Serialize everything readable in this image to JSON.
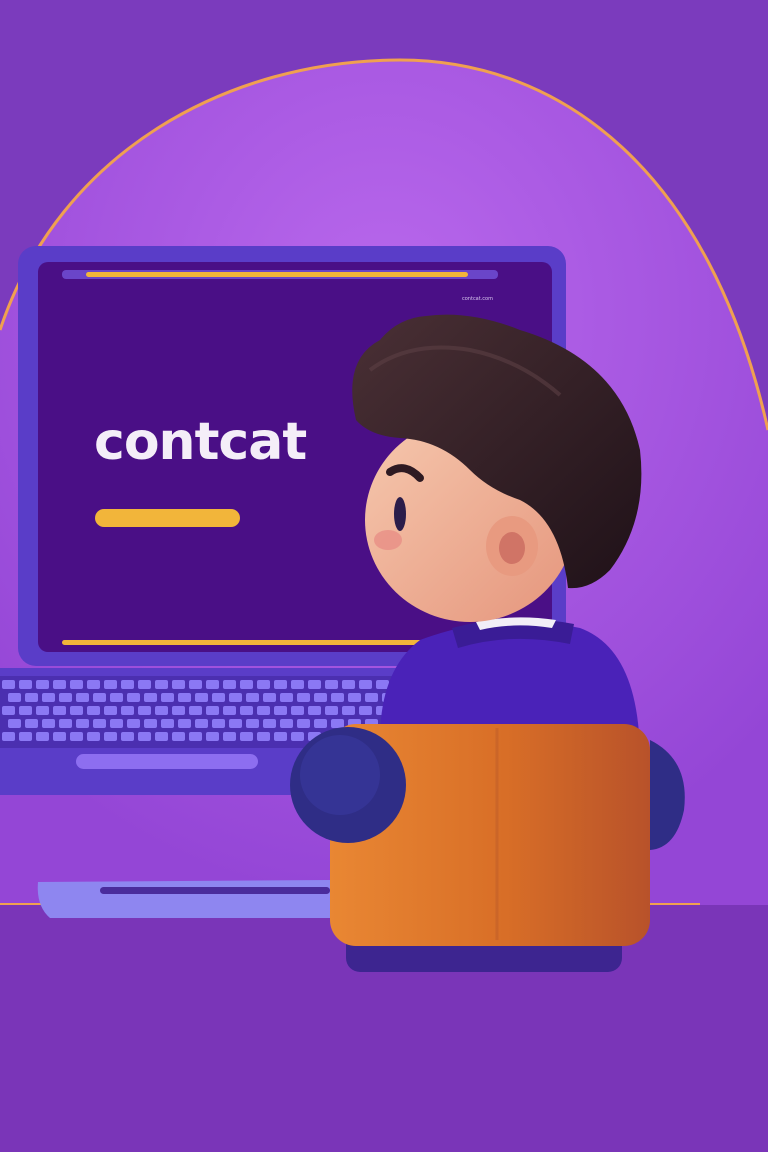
{
  "scene": {
    "screen_text": "contcat",
    "screen_corner_text": "contcat.com",
    "colors": {
      "background": "#7b3bbd",
      "arch": "#a555e0",
      "arch_outline": "#f0a050",
      "laptop_body": "#5a3dc8",
      "screen": "#4a0f86",
      "accent_bar": "#f2b53a",
      "hair": "#2e1a22",
      "skin": "#f0b49a",
      "shirt": "#4a22b8",
      "chair": "#e07a2a",
      "chair_base": "#3d2590"
    }
  }
}
